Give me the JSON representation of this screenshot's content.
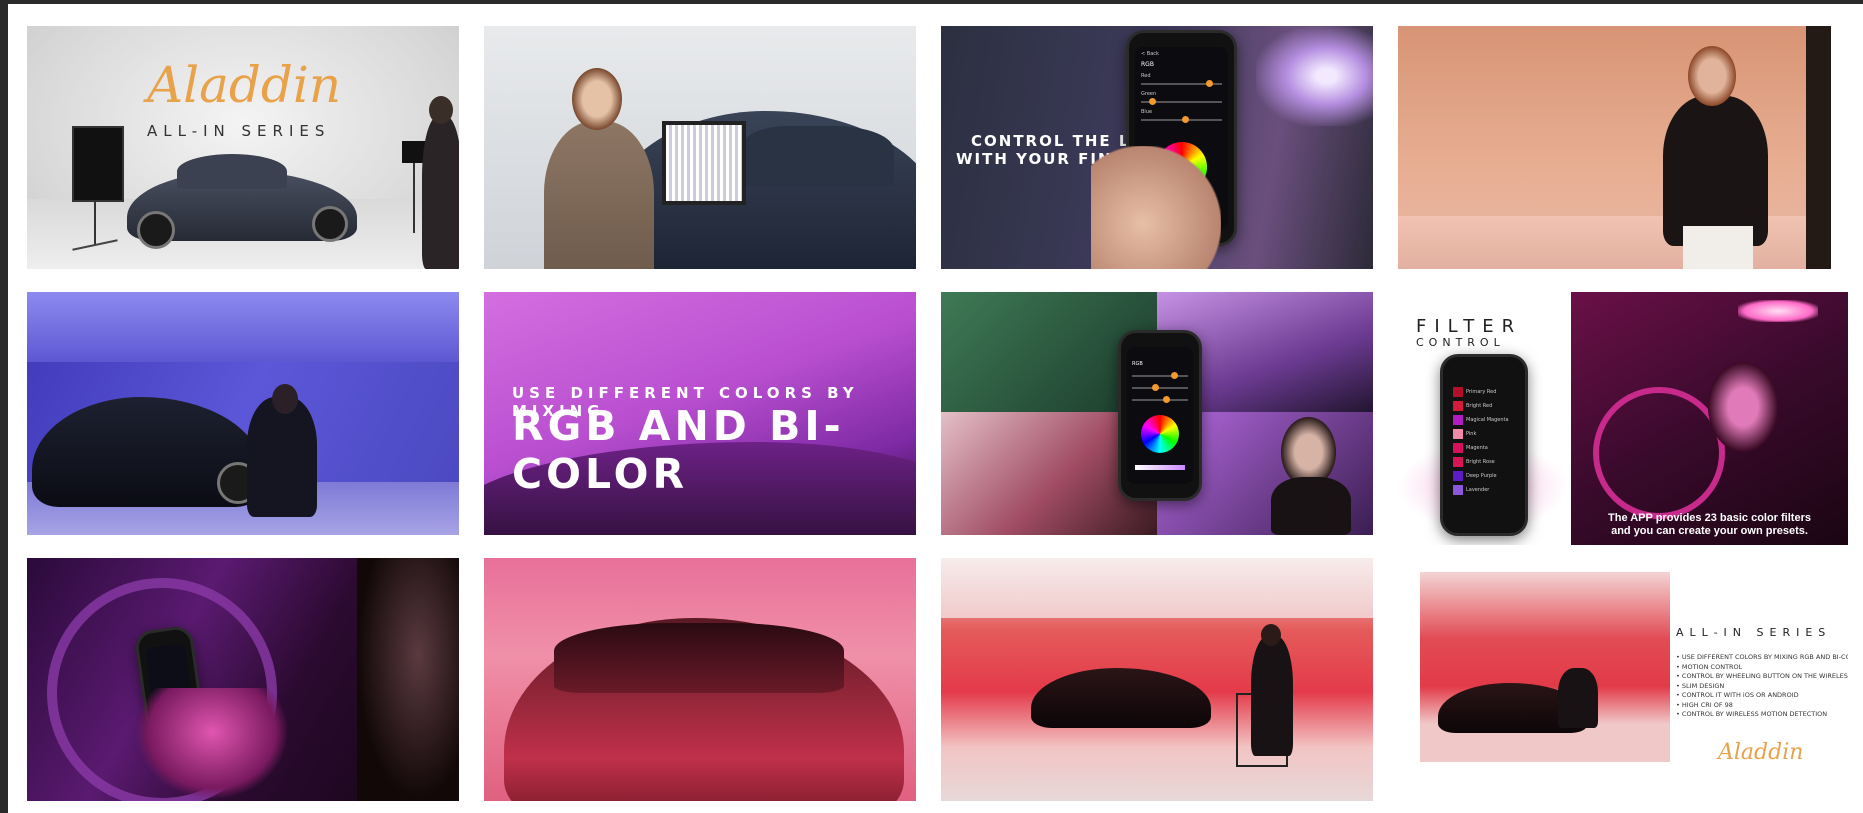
{
  "tiles": {
    "t1": {
      "brand": "Aladdin",
      "series": "ALL-IN SERIES"
    },
    "t3": {
      "headline_1": "CONTROL THE LIGHT",
      "headline_2": "WITH YOUR FINGERTIPS",
      "app": {
        "back": "< Back",
        "title": "RGB",
        "rows": [
          "Red",
          "Green",
          "Blue"
        ]
      }
    },
    "t6": {
      "line_1": "USE DIFFERENT COLORS BY MIXING",
      "line_2": "RGB AND BI-COLOR"
    },
    "t8": {
      "title_1": "FILTER",
      "title_2": "CONTROL",
      "caption_1": "The APP provides 23 basic color filters",
      "caption_2": "and you can create your own presets.",
      "filters": [
        "Primary Red",
        "Bright Red",
        "Magical Magenta",
        "Pink",
        "Magenta",
        "Bright Rose",
        "Deep Purple",
        "Lavender"
      ]
    },
    "t12": {
      "series": "ALL-IN SERIES",
      "features": [
        "• USE DIFFERENT COLORS BY MIXING RGB AND BI-COLOR",
        "• MOTION CONTROL",
        "• CONTROL BY WHEELING BUTTON ON THE WIRELESS CONTROLLER",
        "• SLIM DESIGN",
        "• CONTROL IT WITH iOS OR ANDROID",
        "• HIGH CRI OF 98",
        "• CONTROL BY WIRELESS MOTION DETECTION"
      ],
      "brand": "Aladdin"
    }
  }
}
